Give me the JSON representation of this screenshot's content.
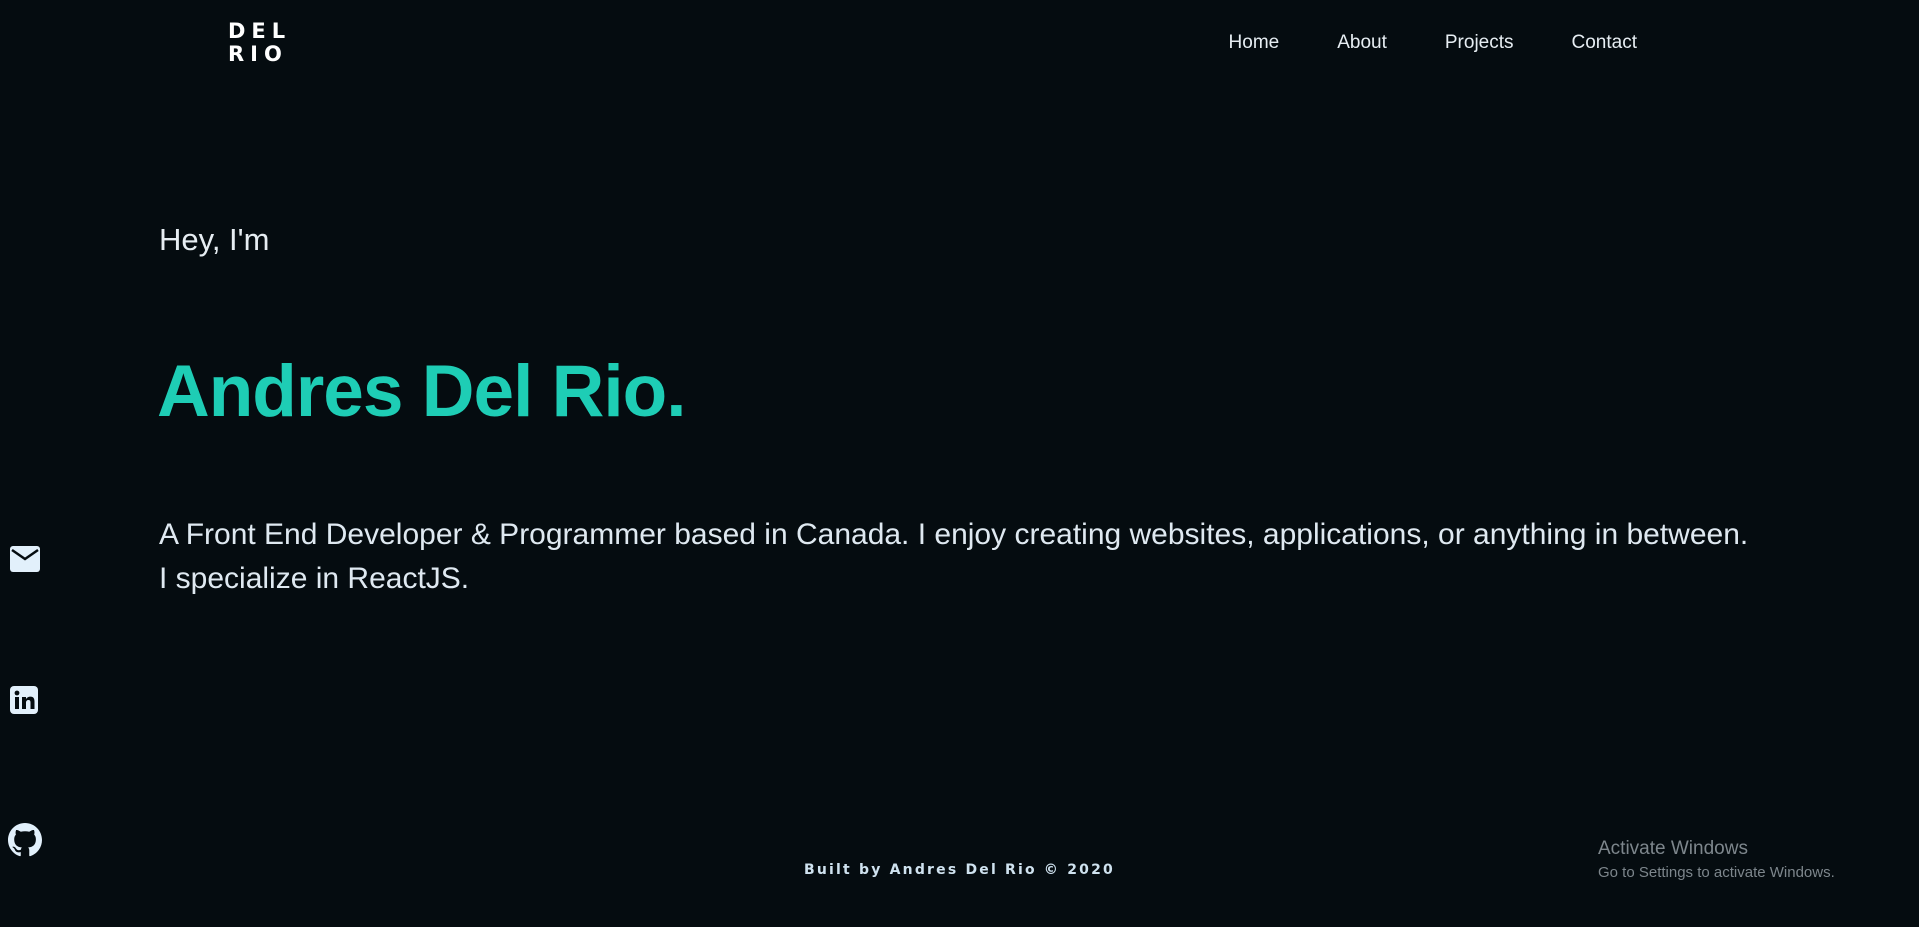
{
  "logo": {
    "line1": "DEL",
    "line2": "RIO"
  },
  "nav": {
    "items": [
      {
        "label": "Home"
      },
      {
        "label": "About"
      },
      {
        "label": "Projects"
      },
      {
        "label": "Contact"
      }
    ]
  },
  "hero": {
    "greeting": "Hey, I'm",
    "name": "Andres Del Rio.",
    "bio": "A Front End Developer & Programmer based in Canada. I enjoy creating websites, applications, or anything in between. I specialize in ReactJS."
  },
  "social": {
    "icons": [
      "mail-icon",
      "linkedin-icon",
      "github-icon"
    ]
  },
  "footer": {
    "text": "Built by Andres Del Rio © 2020"
  },
  "watermark": {
    "title": "Activate Windows",
    "subtitle": "Go to Settings to activate Windows."
  },
  "colors": {
    "background": "#050c10",
    "accent": "#1ecdb5",
    "text": "#e6edf2"
  }
}
